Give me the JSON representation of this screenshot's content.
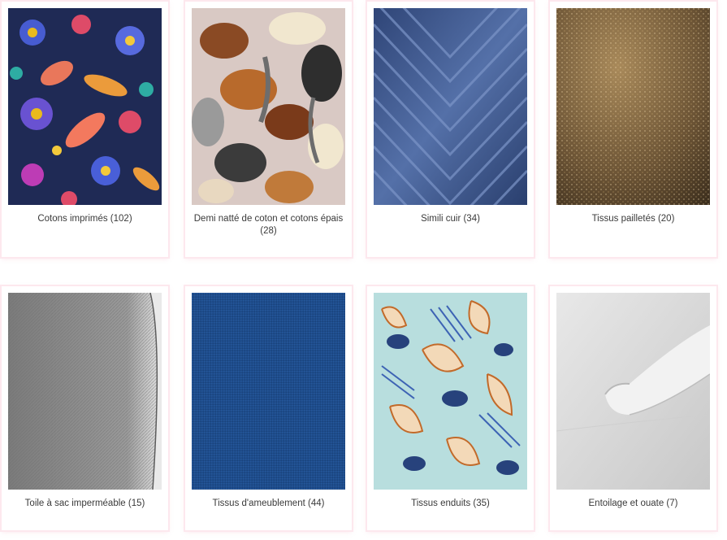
{
  "categories": [
    {
      "label": "Cotons imprimés (102)",
      "image": "floral-printed-cotton-fabric"
    },
    {
      "label": "Demi natté de coton et cotons épais (28)",
      "image": "bird-leaf-pattern-thick-cotton-fabric"
    },
    {
      "label": "Simili cuir (34)",
      "image": "blue-chevron-faux-leather"
    },
    {
      "label": "Tissus pailletés (20)",
      "image": "gold-glitter-fabric"
    },
    {
      "label": "Toile à sac imperméable (15)",
      "image": "grey-waterproof-canvas-roll"
    },
    {
      "label": "Tissus d'ameublement (44)",
      "image": "blue-upholstery-fabric"
    },
    {
      "label": "Tissus enduits (35)",
      "image": "leaf-print-coated-fabric"
    },
    {
      "label": "Entoilage et ouate (7)",
      "image": "white-interfacing-roll"
    }
  ],
  "colors": {
    "card_border": "#fde8ee",
    "label_text": "#3a3a3a"
  }
}
